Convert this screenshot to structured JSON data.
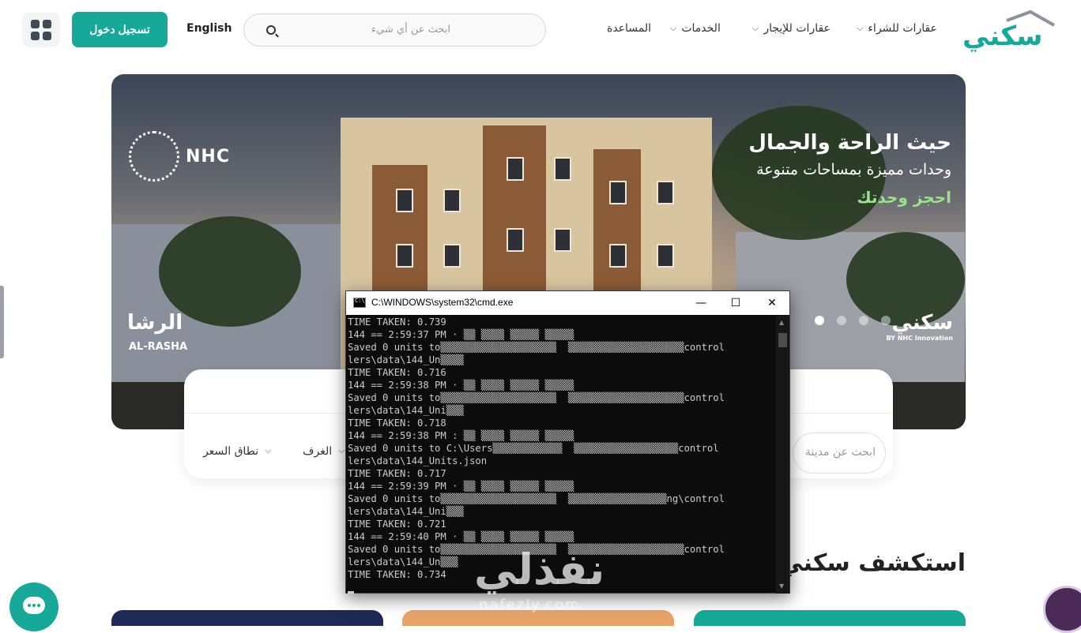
{
  "nav": {
    "logo_text": "سكني",
    "menu": [
      {
        "label": "عقارات للشراء",
        "has_dropdown": true
      },
      {
        "label": "عقارات للإيجار",
        "has_dropdown": true
      },
      {
        "label": "الخدمات",
        "has_dropdown": true
      },
      {
        "label": "المساعدة",
        "has_dropdown": false
      }
    ],
    "search_placeholder": "ابحث عن أي شيء",
    "language": "English",
    "login_label": "تسجيل دخول",
    "apps_icon": "grid-icon"
  },
  "hero": {
    "title": "حيث الراحة والجمال",
    "subtitle": "وحدات مميزة بمساحات متنوعة",
    "cta": "احجز وحدتك",
    "brand": "NHC",
    "project_ar": "الرشا",
    "project_en": "AL-RASHA",
    "sakani_logo": "سكني",
    "sakani_tagline": "BY NHC Innovation",
    "slides_count": 4,
    "active_slide": 1
  },
  "search_panel": {
    "city_placeholder": "ابحث عن مدينة",
    "rooms_label": "الغرف",
    "price_label": "نطاق السعر"
  },
  "section": {
    "explore_title": "استكشف سكني"
  },
  "cmd": {
    "title": "C:\\WINDOWS\\system32\\cmd.exe",
    "lines": [
      "TIME TAKEN: 0.739",
      "144 == 2:59:37 PM · ▒▒ ▒▒▒▒ ▒▒▒▒▒ ▒▒▒▒▒",
      "Saved 0 units to▒▒▒▒▒▒▒▒▒▒▒▒▒▒▒▒▒▒▒▒  ▒▒▒▒▒▒▒▒▒▒▒▒▒▒▒▒▒▒▒▒control",
      "lers\\data\\144_Un▒▒▒▒",
      "TIME TAKEN: 0.716",
      "144 == 2:59:38 PM · ▒▒ ▒▒▒▒ ▒▒▒▒▒ ▒▒▒▒▒",
      "Saved 0 units to▒▒▒▒▒▒▒▒▒▒▒▒▒▒▒▒▒▒▒▒  ▒▒▒▒▒▒▒▒▒▒▒▒▒▒▒▒▒▒▒▒control",
      "lers\\data\\144_Uni▒▒▒",
      "TIME TAKEN: 0.718",
      "144 == 2:59:38 PM : ▒▒ ▒▒▒▒ ▒▒▒▒▒ ▒▒▒▒▒",
      "Saved 0 units to C:\\Users▒▒▒▒▒▒▒▒▒▒▒▒  ▒▒▒▒▒▒▒▒▒▒▒▒▒▒▒▒▒▒control",
      "lers\\data\\144_Units.json",
      "TIME TAKEN: 0.717",
      "144 == 2:59:39 PM · ▒▒ ▒▒▒▒ ▒▒▒▒▒ ▒▒▒▒▒",
      "Saved 0 units to▒▒▒▒▒▒▒▒▒▒▒▒▒▒▒▒▒▒▒▒  ▒▒▒▒▒▒▒▒▒▒▒▒▒▒▒▒▒ng\\control",
      "lers\\data\\144_Uni▒▒▒",
      "TIME TAKEN: 0.721",
      "144 == 2:59:40 PM · ▒▒ ▒▒▒▒ ▒▒▒▒▒ ▒▒▒▒▒",
      "Saved 0 units to▒▒▒▒▒▒▒▒▒▒▒▒▒▒▒▒▒▒▒▒  ▒▒▒▒▒▒▒▒▒▒▒▒▒▒▒▒▒▒▒▒control",
      "lers\\data\\144_Un▒▒▒",
      "TIME TAKEN: 0.734"
    ]
  },
  "watermark": {
    "ar": "نفذلي",
    "en": "nafezly.com"
  },
  "colors": {
    "brand": "#16a99a",
    "cta_green": "#9be28d",
    "cmd_bg": "#0c0c0c"
  }
}
